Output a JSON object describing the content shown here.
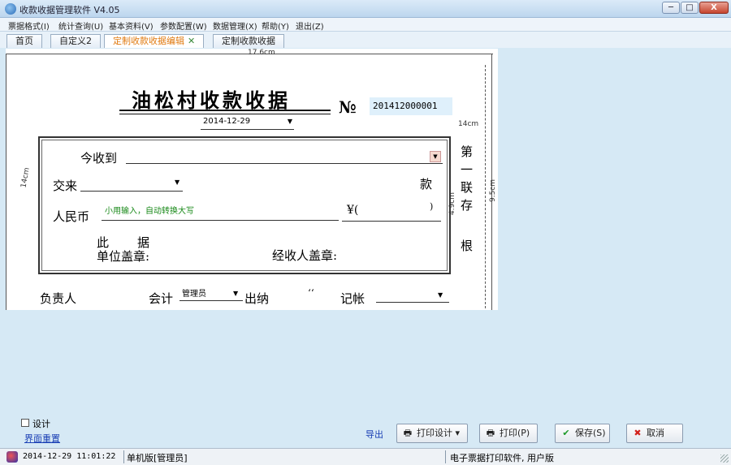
{
  "window": {
    "title": "收款收据管理软件 V4.05",
    "min_label": "─",
    "max_label": "□",
    "close_label": "X"
  },
  "menu": {
    "items": [
      "票据格式(I)",
      "统计查询(U)",
      "基本资料(V)",
      "参数配置(W)",
      "数据管理(X)",
      "帮助(Y)",
      "退出(Z)"
    ]
  },
  "tabs": {
    "items": [
      "首页",
      "自定义2",
      "定制收款收据编辑",
      "定制收款收据"
    ],
    "active_index": 2
  },
  "receipt": {
    "title": "油松村收款收据",
    "no_label": "№",
    "no_value": "201412000001",
    "date": "2014-12-29",
    "receive_label": "今收到",
    "from_label": "交来",
    "kuan_label": "款",
    "rmb_label": "人民币",
    "rmb_placeholder": "小用输入，自动转换大写",
    "yen_label": "¥(",
    "paren_close": ")",
    "ci_label": "此",
    "ju_label": "据",
    "unit_seal_label": "单位盖章:",
    "handler_seal_label": "经收人盖章:",
    "copy_chars": [
      "第",
      "一",
      "联",
      "存",
      "根"
    ],
    "responsible_label": "负责人",
    "accountant_label": "会计",
    "accountant_value": "管理员",
    "cashier_label": "出纳",
    "cashier_marks": "‘‘",
    "bookkeeper_label": "记帐",
    "hand_notes": [
      "17.6cm",
      "14cm",
      "9.5cm",
      "4.9cm",
      "14cm"
    ]
  },
  "bottom": {
    "design_label": "设计",
    "reset_label": "界面重置",
    "export_label": "导出",
    "print_design_label": "打印设计",
    "print_label": "打印(P)",
    "save_label": "保存(S)",
    "cancel_label": "取消"
  },
  "status": {
    "datetime": "2014-12-29 11:01:22",
    "mode": "单机版[管理员]",
    "product": "电子票据打印软件, 用户版"
  },
  "colors": {
    "active_tab_text": "#e07a10",
    "link": "#1a3fb5",
    "hint_text": "#1a8a1a",
    "background": "#d6e9f5"
  }
}
